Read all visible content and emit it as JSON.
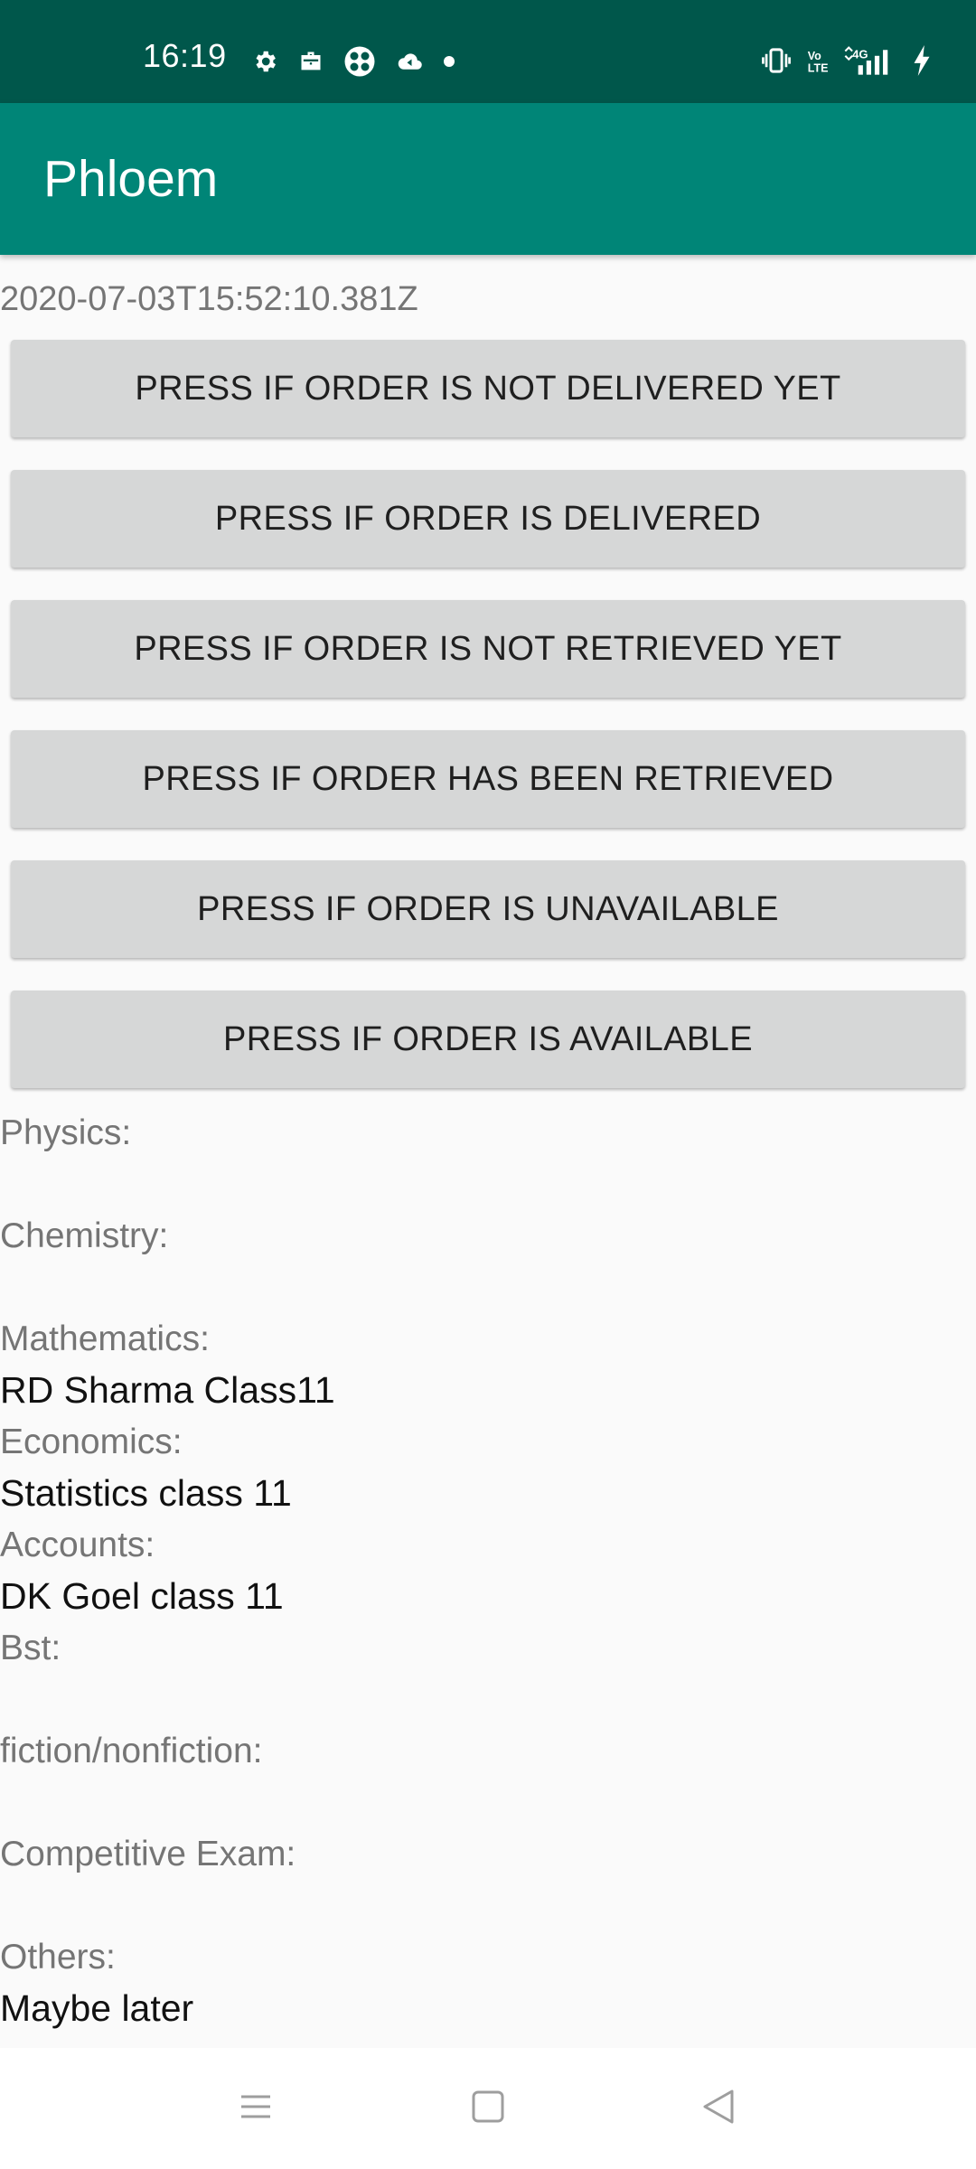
{
  "status_bar": {
    "time": "16:19",
    "left_icons": [
      "settings-icon",
      "briefcase-icon",
      "app-icon",
      "cloud-icon",
      "notification-dot-icon"
    ],
    "right_icons": [
      "vibrate-icon",
      "volte-icon",
      "4g-signal-icon",
      "battery-charging-icon"
    ],
    "network_label": "4G"
  },
  "app_bar": {
    "title": "Phloem"
  },
  "timestamp": "2020-07-03T15:52:10.381Z",
  "buttons": [
    "PRESS IF ORDER IS NOT DELIVERED YET",
    "PRESS IF ORDER IS DELIVERED",
    "PRESS IF ORDER IS NOT RETRIEVED YET",
    "PRESS IF ORDER HAS BEEN RETRIEVED",
    "PRESS IF ORDER IS UNAVAILABLE",
    "PRESS IF ORDER IS AVAILABLE"
  ],
  "details": [
    {
      "label": "Physics:",
      "value": ""
    },
    {
      "label": "Chemistry:",
      "value": ""
    },
    {
      "label": "Mathematics:",
      "value": "RD Sharma Class11"
    },
    {
      "label": "Economics:",
      "value": "Statistics class 11"
    },
    {
      "label": "Accounts:",
      "value": "DK Goel class 11"
    },
    {
      "label": "Bst:",
      "value": ""
    },
    {
      "label": "fiction/nonfiction:",
      "value": ""
    },
    {
      "label": "Competitive Exam:",
      "value": ""
    },
    {
      "label": "Others:",
      "value": "Maybe later"
    }
  ],
  "nav_bar": {
    "buttons": [
      "menu-icon",
      "home-icon",
      "back-icon"
    ]
  },
  "colors": {
    "status_bar": "#00574b",
    "app_bar": "#008577",
    "button_bg": "#d6d7d7",
    "label_text": "#757575",
    "value_text": "#111111"
  }
}
